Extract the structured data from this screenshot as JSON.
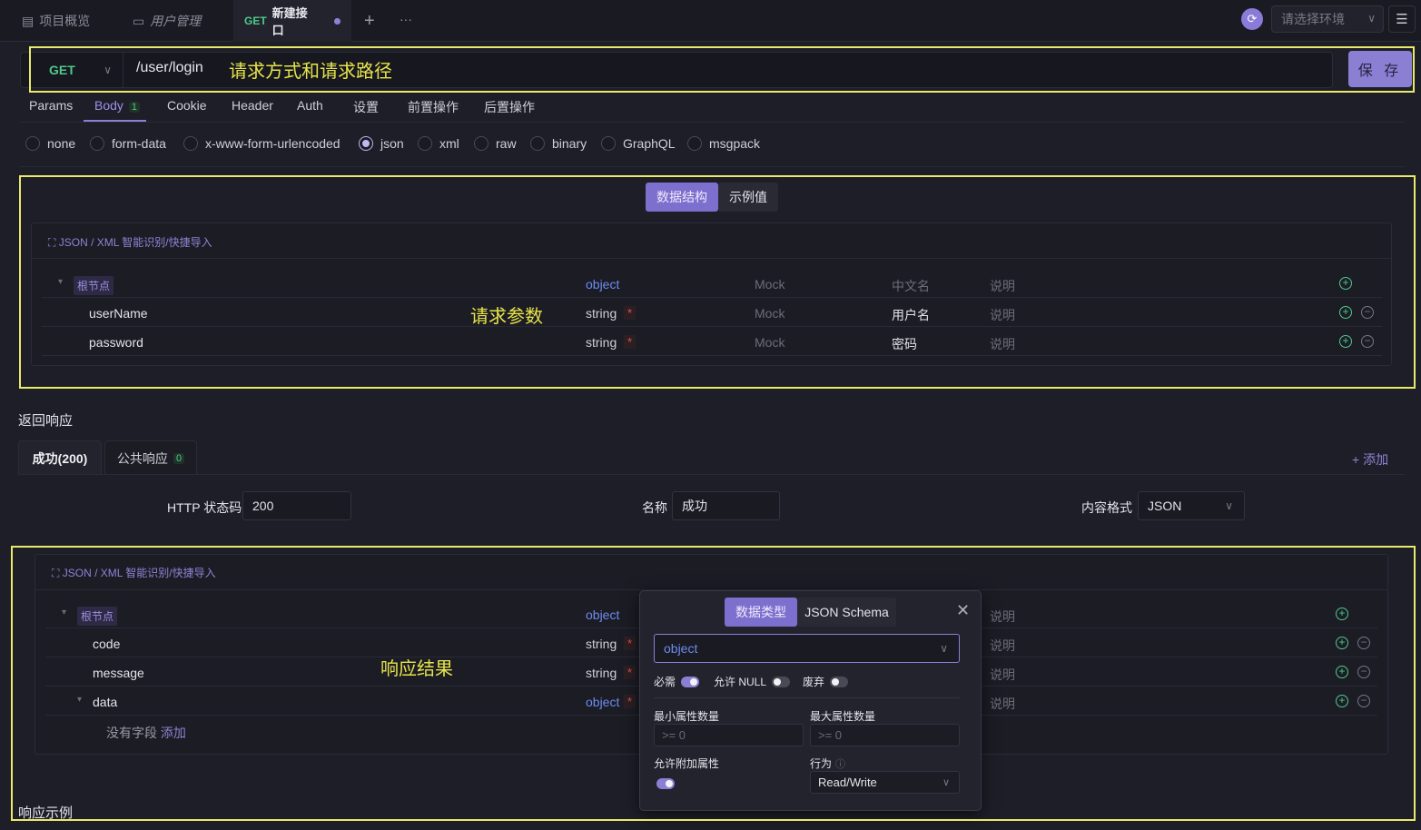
{
  "tabs": {
    "overview": "项目概览",
    "users": "用户管理",
    "active_method": "GET",
    "active_label": "新建接口",
    "add": "+",
    "more": "···"
  },
  "env": {
    "placeholder": "请选择环境"
  },
  "request": {
    "method": "GET",
    "path": "/user/login",
    "save_label": "保 存"
  },
  "annotations": {
    "method_path": "请求方式和请求路径",
    "request_params": "请求参数",
    "response_result": "响应结果"
  },
  "req_tabs": [
    "Params",
    "Body",
    "Cookie",
    "Header",
    "Auth",
    "设置",
    "前置操作",
    "后置操作"
  ],
  "body_count": "1",
  "body_types": [
    "none",
    "form-data",
    "x-www-form-urlencoded",
    "json",
    "xml",
    "raw",
    "binary",
    "GraphQL",
    "msgpack"
  ],
  "body_selected": "json",
  "schema_tabs": {
    "structure": "数据结构",
    "example": "示例值"
  },
  "import_label": "JSON / XML 智能识别/快捷导入",
  "request_schema": {
    "root_label": "根节点",
    "root_type": "object",
    "header_mock": "Mock",
    "header_cn": "中文名",
    "header_desc": "说明",
    "rows": [
      {
        "name": "userName",
        "type": "string",
        "required": "*",
        "mock": "Mock",
        "cn": "用户名",
        "desc": "说明"
      },
      {
        "name": "password",
        "type": "string",
        "required": "*",
        "mock": "Mock",
        "cn": "密码",
        "desc": "说明"
      }
    ]
  },
  "response": {
    "section_title": "返回响应",
    "tab_success": "成功(200)",
    "tab_common": "公共响应",
    "tab_common_count": "0",
    "add_label": "+ 添加",
    "status_label": "HTTP 状态码",
    "status_value": "200",
    "name_label": "名称",
    "name_value": "成功",
    "format_label": "内容格式",
    "format_value": "JSON"
  },
  "response_schema": {
    "root_label": "根节点",
    "root_type": "object",
    "root_desc": "说明",
    "rows": [
      {
        "name": "code",
        "type": "string",
        "required": "*",
        "desc": "说明"
      },
      {
        "name": "message",
        "type": "string",
        "required": "*",
        "desc": "说明"
      },
      {
        "name": "data",
        "type": "object",
        "required": "*",
        "desc": "说明"
      }
    ],
    "empty_text": "没有字段",
    "empty_add": "添加"
  },
  "popover": {
    "tab_type": "数据类型",
    "tab_schema": "JSON Schema",
    "type_value": "object",
    "required_label": "必需",
    "allow_null_label": "允许 NULL",
    "deprecated_label": "废弃",
    "required_on": true,
    "allow_null_on": false,
    "deprecated_on": false,
    "min_props_label": "最小属性数量",
    "max_props_label": "最大属性数量",
    "min_props_placeholder": ">= 0",
    "max_props_placeholder": ">= 0",
    "additional_label": "允许附加属性",
    "additional_on": true,
    "behavior_label": "行为",
    "behavior_value": "Read/Write"
  },
  "example_title": "响应示例",
  "colors": {
    "accent": "#8b7fd4",
    "get": "#4ec98a",
    "annotation": "#e6e44a",
    "object": "#6c8cf0",
    "required": "#e0504a"
  }
}
